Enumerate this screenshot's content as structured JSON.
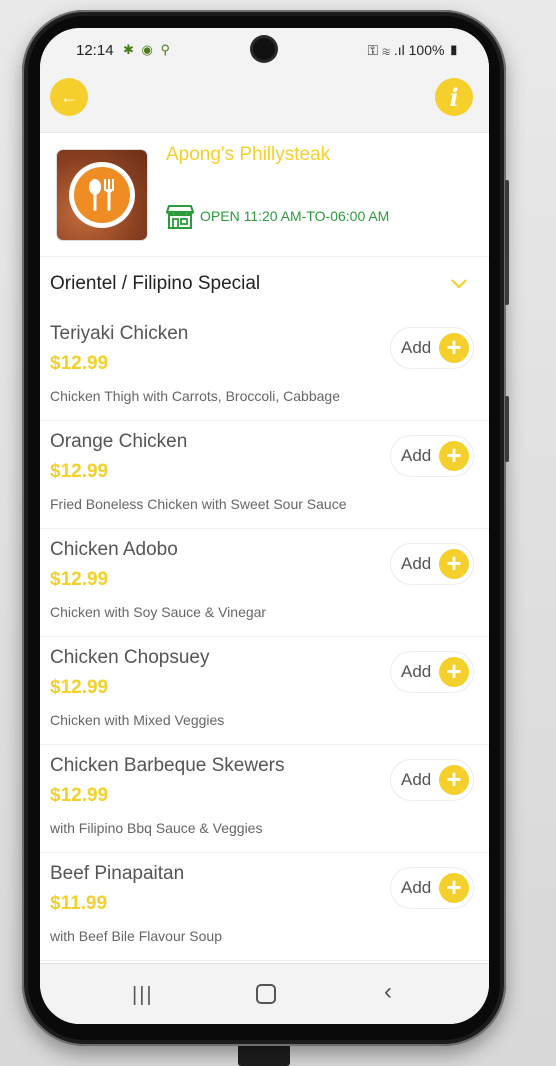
{
  "status_bar": {
    "time": "12:14",
    "battery": "100%"
  },
  "app_bar": {
    "back_icon": "arrow-left-icon",
    "info_icon": "info-icon"
  },
  "restaurant": {
    "name": "Apong's Phillysteak",
    "hours": "OPEN 11:20 AM-TO-06:00 AM"
  },
  "category": {
    "title": "Orientel / Filipino Special"
  },
  "menu": {
    "add_label": "Add",
    "items": [
      {
        "name": "Teriyaki Chicken",
        "price": "$12.99",
        "desc": "Chicken Thigh with Carrots, Broccoli, Cabbage"
      },
      {
        "name": "Orange Chicken",
        "price": "$12.99",
        "desc": "Fried Boneless Chicken with Sweet Sour Sauce"
      },
      {
        "name": "Chicken Adobo",
        "price": "$12.99",
        "desc": "Chicken with Soy Sauce & Vinegar"
      },
      {
        "name": "Chicken Chopsuey",
        "price": "$12.99",
        "desc": "Chicken with Mixed Veggies"
      },
      {
        "name": "Chicken Barbeque Skewers",
        "price": "$12.99",
        "desc": "with Filipino Bbq Sauce & Veggies"
      },
      {
        "name": "Beef Pinapaitan",
        "price": "$11.99",
        "desc": "with Beef Bile Flavour Soup"
      }
    ]
  },
  "colors": {
    "accent": "#f5cf2b",
    "open_green": "#2c9b3a"
  }
}
